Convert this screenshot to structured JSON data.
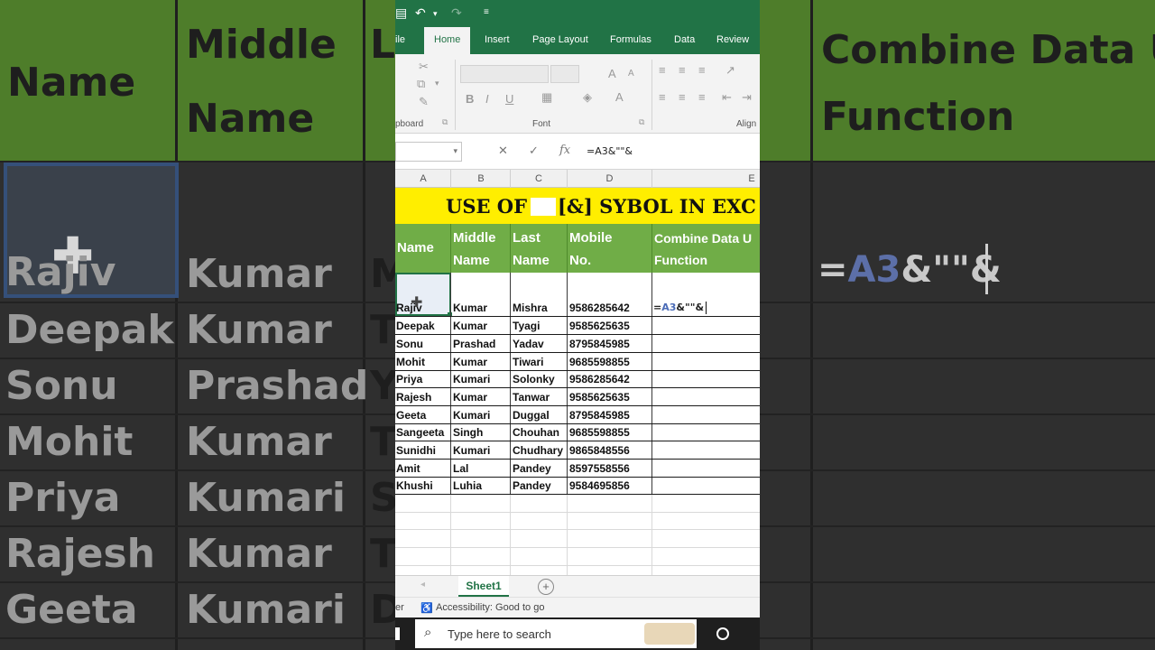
{
  "background": {
    "header_col1": "Name",
    "header_col2_line1": "Middle",
    "header_col2_line2": "Name",
    "header_col3": "L",
    "header_col4_line1": "Combine Data U",
    "header_col4_line2": "Function",
    "rows": [
      {
        "first": "Rajiv",
        "middle": "Kumar",
        "last": "M"
      },
      {
        "first": "Deepak",
        "middle": "Kumar",
        "last": "T"
      },
      {
        "first": "Sonu",
        "middle": "Prashad",
        "last": "Y"
      },
      {
        "first": "Mohit",
        "middle": "Kumar",
        "last": "T"
      },
      {
        "first": "Priya",
        "middle": "Kumari",
        "last": "S"
      },
      {
        "first": "Rajesh",
        "middle": "Kumar",
        "last": "T"
      },
      {
        "first": "Geeta",
        "middle": "Kumari",
        "last": "D"
      }
    ],
    "formula_prefix": "=",
    "formula_ref": "A3",
    "formula_rest": "&\"\"&"
  },
  "excel": {
    "tabs": {
      "file_partial": "ile",
      "home": "Home",
      "insert": "Insert",
      "page_layout": "Page Layout",
      "formulas": "Formulas",
      "data": "Data",
      "review": "Review"
    },
    "ribbon": {
      "clipboard_label": "pboard",
      "font_label": "Font",
      "align_label": "Align",
      "bold": "B",
      "italic": "I",
      "underline": "U"
    },
    "formula_bar": {
      "fx": "fx",
      "content": "=A3&\"\"&"
    },
    "column_headers": [
      "A",
      "B",
      "C",
      "D",
      "E"
    ],
    "banner_left": "USE OF",
    "banner_right": "[&] SYBOL IN EXC",
    "table_headers": {
      "name": "Name",
      "middle_line1": "Middle",
      "middle_line2": "Name",
      "last_line1": "Last",
      "last_line2": "Name",
      "mobile_line1": "Mobile",
      "mobile_line2": "No.",
      "combine_line1": "Combine Data U",
      "combine_line2": "Function"
    },
    "rows": [
      {
        "first": "Rajiv",
        "middle": "Kumar",
        "last": "Mishra",
        "mobile": "9586285642"
      },
      {
        "first": "Deepak",
        "middle": "Kumar",
        "last": "Tyagi",
        "mobile": "9585625635"
      },
      {
        "first": "Sonu",
        "middle": "Prashad",
        "last": "Yadav",
        "mobile": "8795845985"
      },
      {
        "first": "Mohit",
        "middle": "Kumar",
        "last": "Tiwari",
        "mobile": "9685598855"
      },
      {
        "first": "Priya",
        "middle": "Kumari",
        "last": "Solonky",
        "mobile": "9586285642"
      },
      {
        "first": "Rajesh",
        "middle": "Kumar",
        "last": "Tanwar",
        "mobile": "9585625635"
      },
      {
        "first": "Geeta",
        "middle": "Kumari",
        "last": "Duggal",
        "mobile": "8795845985"
      },
      {
        "first": "Sangeeta",
        "middle": "Singh",
        "last": "Chouhan",
        "mobile": "9685598855"
      },
      {
        "first": "Sunidhi",
        "middle": "Kumari",
        "last": "Chudhary",
        "mobile": "9865848556"
      },
      {
        "first": "Amit",
        "middle": "Lal",
        "last": "Pandey",
        "mobile": "8597558556"
      },
      {
        "first": "Khushi",
        "middle": "Luhia",
        "last": "Pandey",
        "mobile": "9584695856"
      }
    ],
    "editing_prefix": "=",
    "editing_ref": "A3",
    "editing_rest": "&\"\"&",
    "sheet_tab": "Sheet1",
    "add_sheet": "+",
    "status_left": "er",
    "status_accessibility": "Accessibility: Good to go"
  },
  "taskbar": {
    "search_placeholder": "Type here to search"
  },
  "colors": {
    "excel_green": "#217346",
    "header_green": "#70ad47",
    "banner_yellow": "#ffee00"
  }
}
